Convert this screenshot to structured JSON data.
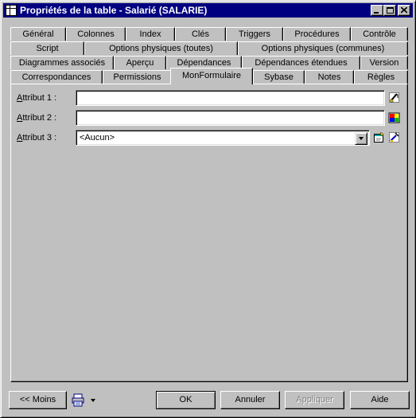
{
  "window": {
    "title": "Propriétés de la table - Salarié (SALARIE)"
  },
  "tabs": {
    "row1": [
      "Général",
      "Colonnes",
      "Index",
      "Clés",
      "Triggers",
      "Procédures",
      "Contrôle"
    ],
    "row2": [
      "Script",
      "Options physiques (toutes)",
      "Options physiques (communes)"
    ],
    "row3": [
      "Diagrammes associés",
      "Aperçu",
      "Dépendances",
      "Dépendances étendues",
      "Version"
    ],
    "row4": [
      "Correspondances",
      "Permissions",
      "MonFormulaire",
      "Sybase",
      "Notes",
      "Règles"
    ],
    "active": "MonFormulaire"
  },
  "form": {
    "attr1_label": "Attribut 1 :",
    "attr1_value": "",
    "attr2_label": "Attribut 2 :",
    "attr2_value": "",
    "attr3_label": "Attribut 3 :",
    "attr3_value": "<Aucun>"
  },
  "footer": {
    "moins_label": "<< Moins",
    "ok_label": "OK",
    "annuler_label": "Annuler",
    "appliquer_label": "Appliquer",
    "aide_label": "Aide"
  },
  "icons": {
    "app": "table-icon",
    "attr1_button": "edit-properties-icon",
    "attr2_button": "color-picker-icon",
    "attr3_create": "create-object-icon",
    "attr3_props": "properties-icon",
    "print": "printer-icon"
  }
}
